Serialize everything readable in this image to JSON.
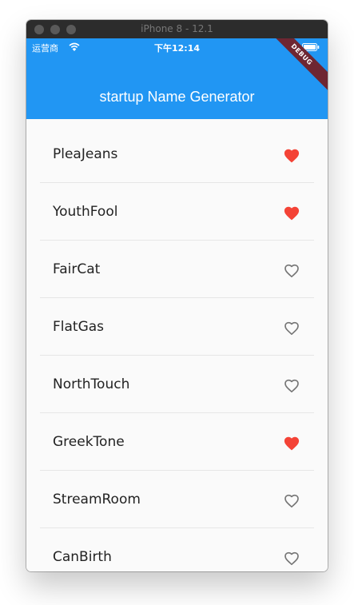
{
  "window": {
    "title": "iPhone 8 - 12.1"
  },
  "status_bar": {
    "carrier": "运营商",
    "wifi_icon": "wifi-icon",
    "time": "下午12:14",
    "battery_icon": "battery-icon"
  },
  "app_bar": {
    "title": "startup Name Generator",
    "color": "#2196f3",
    "debug_banner": "DEBUG"
  },
  "colors": {
    "heart_saved": "#f44336",
    "heart_unsaved": "#757575"
  },
  "list": {
    "items": [
      {
        "label": "PleaJeans",
        "saved": true,
        "icon": "heart-filled-icon"
      },
      {
        "label": "YouthFool",
        "saved": true,
        "icon": "heart-filled-icon"
      },
      {
        "label": "FairCat",
        "saved": false,
        "icon": "heart-outline-icon"
      },
      {
        "label": "FlatGas",
        "saved": false,
        "icon": "heart-outline-icon"
      },
      {
        "label": "NorthTouch",
        "saved": false,
        "icon": "heart-outline-icon"
      },
      {
        "label": "GreekTone",
        "saved": true,
        "icon": "heart-filled-icon"
      },
      {
        "label": "StreamRoom",
        "saved": false,
        "icon": "heart-outline-icon"
      },
      {
        "label": "CanBirth",
        "saved": false,
        "icon": "heart-outline-icon"
      }
    ]
  }
}
